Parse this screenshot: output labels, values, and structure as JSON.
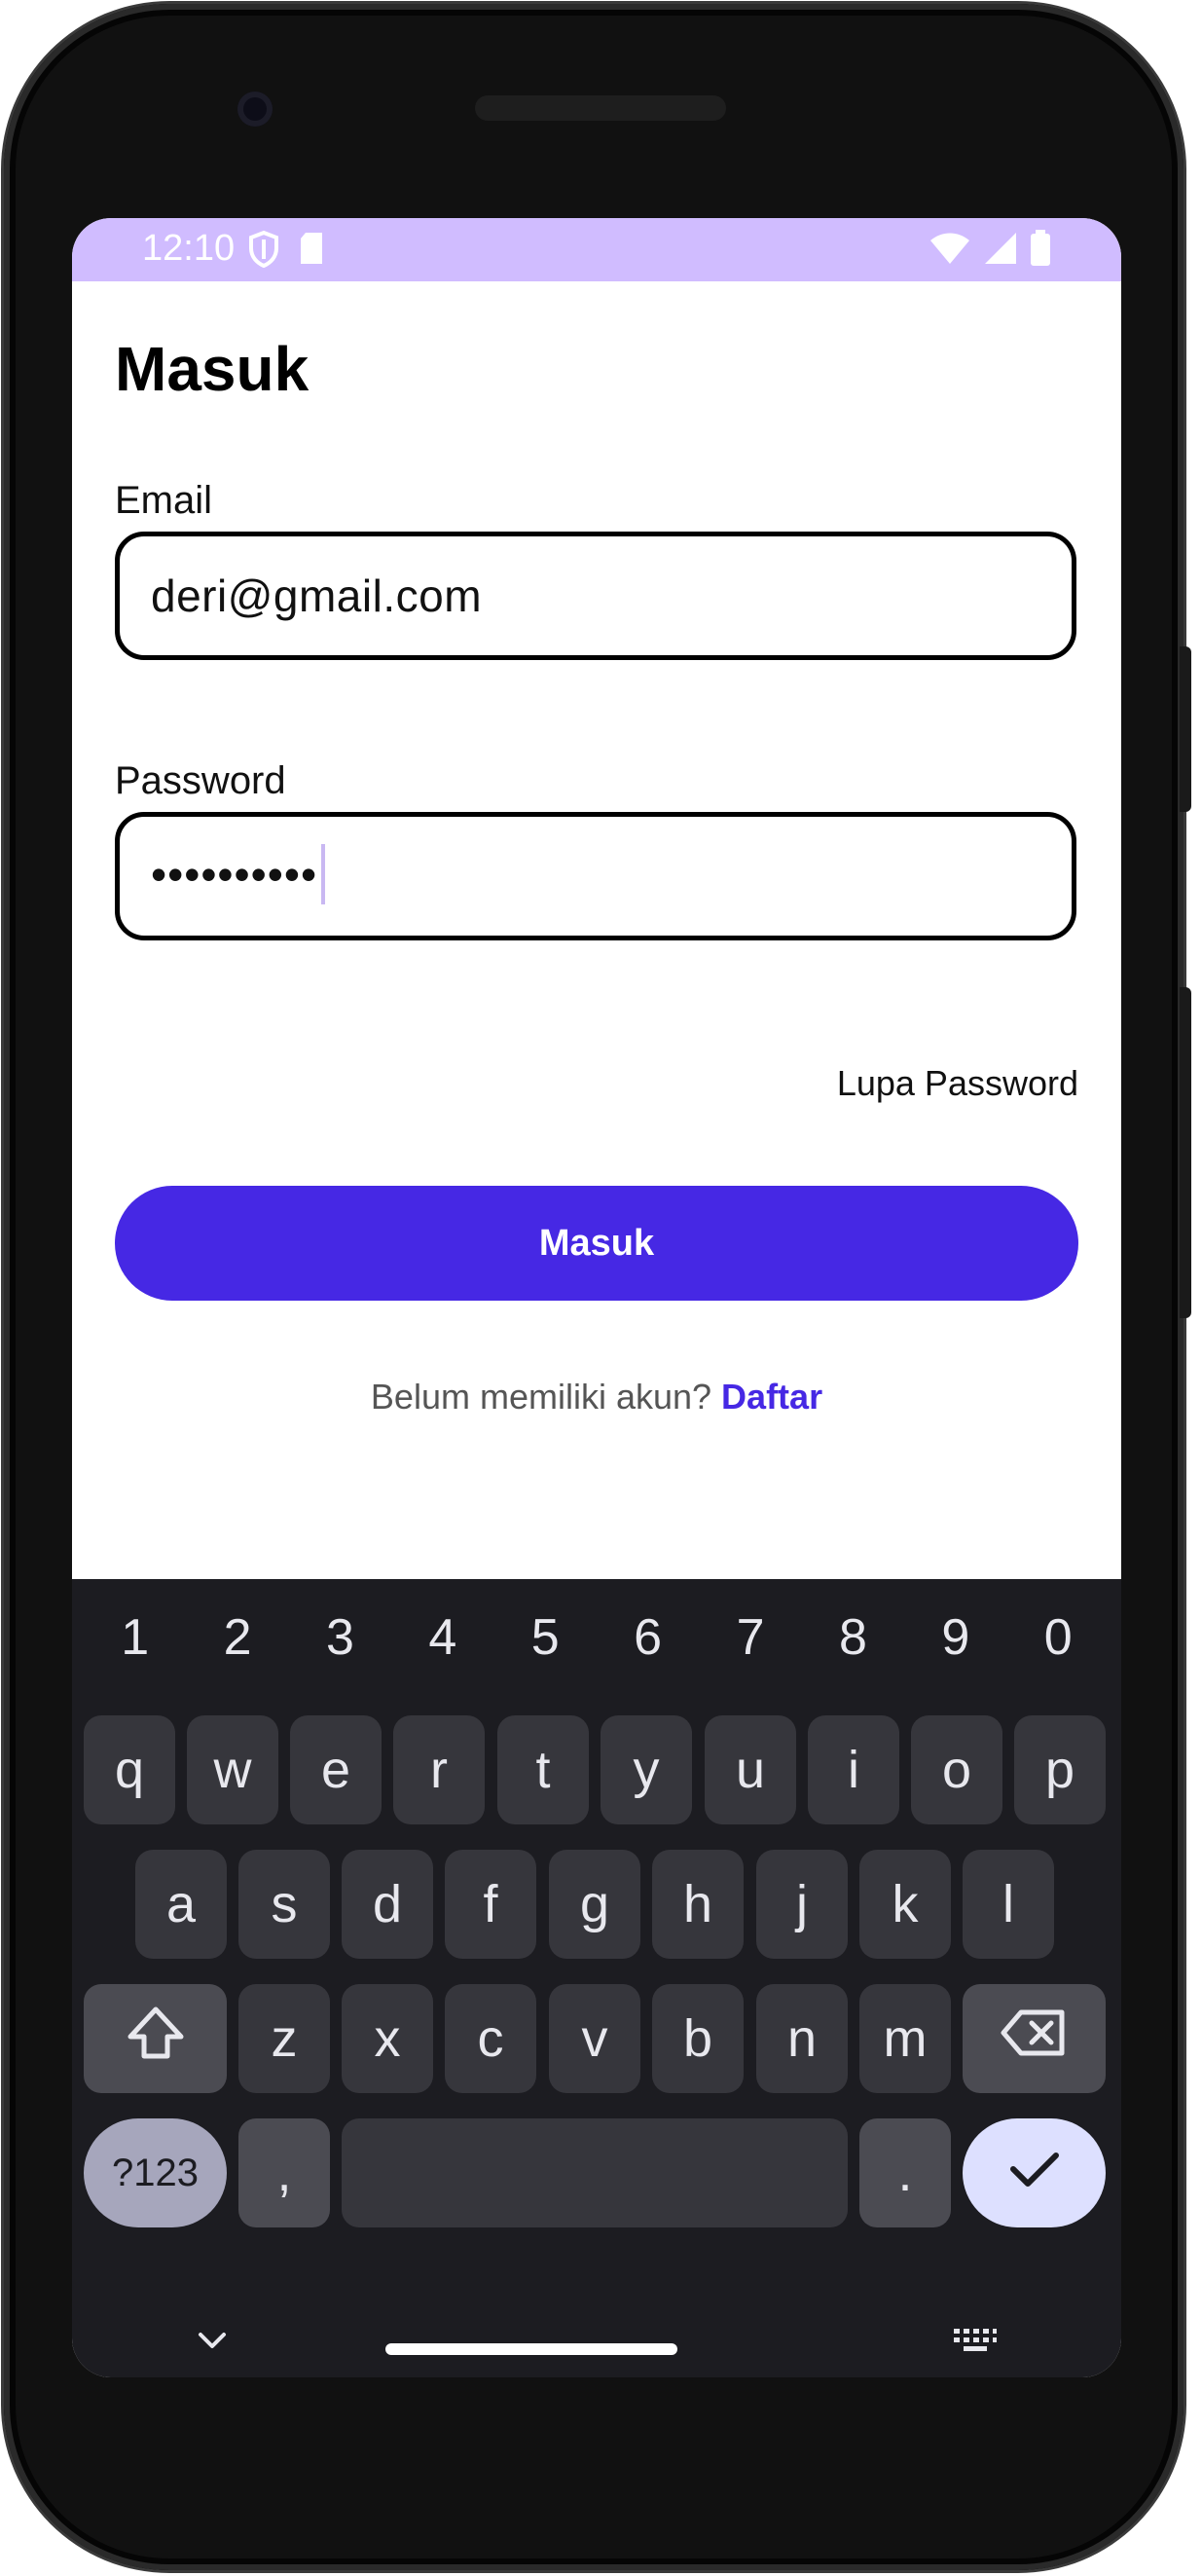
{
  "status_bar": {
    "time": "12:10",
    "background": "#d0bcff"
  },
  "screen": {
    "title": "Masuk",
    "email": {
      "label": "Email",
      "value": "deri@gmail.com"
    },
    "password": {
      "label": "Password",
      "masked_value": "••••••••••"
    },
    "forgot_password_link": "Lupa Password",
    "login_button": "Masuk",
    "register_prompt": "Belum memiliki akun?",
    "register_link": "Daftar",
    "accent_color": "#4628e4"
  },
  "keyboard": {
    "number_row": [
      "1",
      "2",
      "3",
      "4",
      "5",
      "6",
      "7",
      "8",
      "9",
      "0"
    ],
    "row1": [
      "q",
      "w",
      "e",
      "r",
      "t",
      "y",
      "u",
      "i",
      "o",
      "p"
    ],
    "row2": [
      "a",
      "s",
      "d",
      "f",
      "g",
      "h",
      "j",
      "k",
      "l"
    ],
    "row3": [
      "z",
      "x",
      "c",
      "v",
      "b",
      "n",
      "m"
    ],
    "symbols_key": "?123",
    "comma_key": ",",
    "period_key": ".",
    "icons": {
      "shift": "shift-icon",
      "backspace": "backspace-icon",
      "enter": "check-icon",
      "hide": "chevron-down-icon",
      "switch_keyboard": "keyboard-icon"
    }
  }
}
